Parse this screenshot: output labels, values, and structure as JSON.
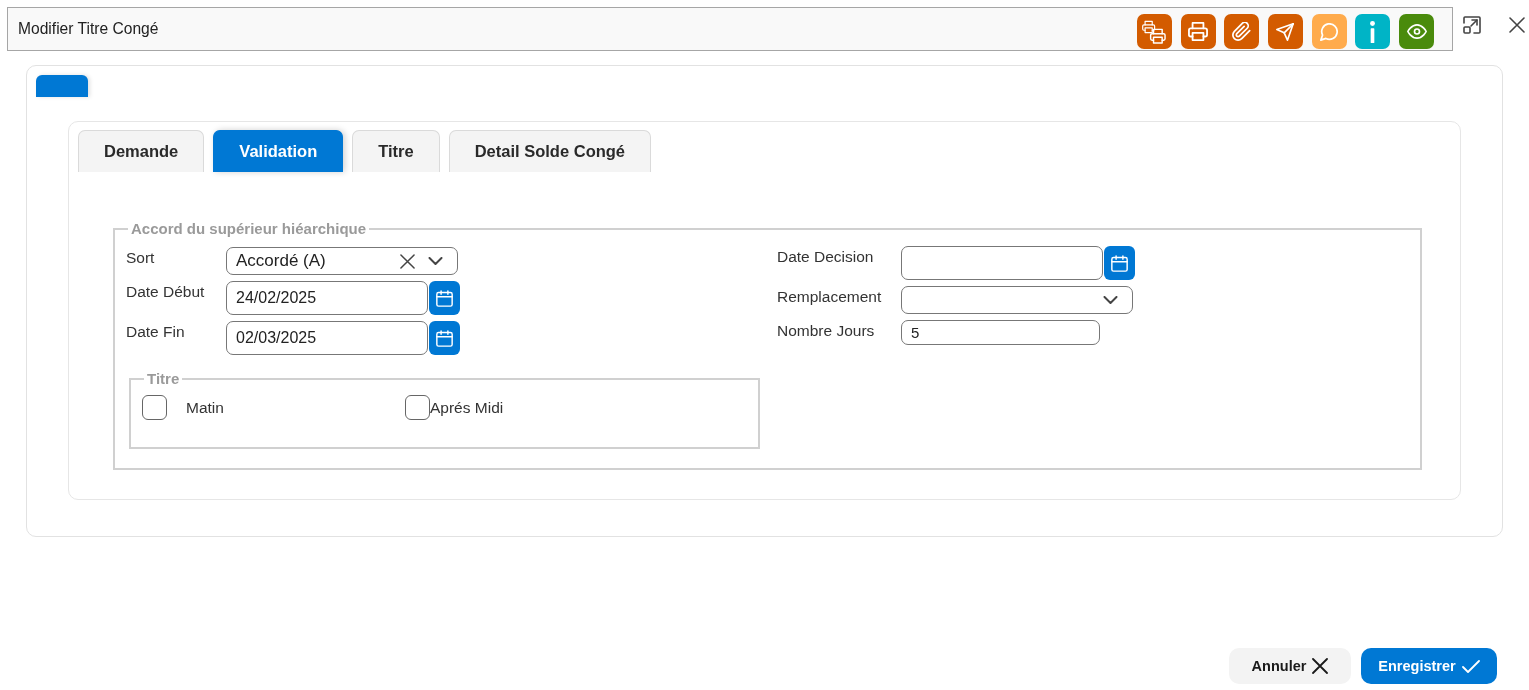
{
  "window": {
    "title": "Modifier Titre Congé"
  },
  "toolbar": [
    {
      "kind": "print-batch",
      "color": "#d35b00"
    },
    {
      "kind": "print",
      "color": "#d35b00"
    },
    {
      "kind": "attach",
      "color": "#d35b00"
    },
    {
      "kind": "send",
      "color": "#d35b00"
    },
    {
      "kind": "comment",
      "color": "#ffab4c"
    },
    {
      "kind": "info",
      "color": "#00b4c6"
    },
    {
      "kind": "view",
      "color": "#4a8b0c"
    }
  ],
  "header_tabs": [
    {
      "selected": true
    }
  ],
  "tabs": [
    {
      "label": "Demande",
      "selected": false
    },
    {
      "label": "Validation",
      "selected": true
    },
    {
      "label": "Titre",
      "selected": false
    },
    {
      "label": "Detail Solde Congé",
      "selected": false
    }
  ],
  "section": {
    "legend": "Accord du supérieur hiéarchique",
    "left_fields": [
      {
        "kind": "select",
        "label": "Sort",
        "value": "Accordé (A)",
        "clearable": true
      },
      {
        "kind": "date",
        "label": "Date Début",
        "value": "24/02/2025"
      },
      {
        "kind": "date",
        "label": "Date Fin",
        "value": "02/03/2025"
      }
    ],
    "right_fields": [
      {
        "kind": "date",
        "label": "Date Decision"
      },
      {
        "kind": "select",
        "label": "Remplacement",
        "clearable": false
      },
      {
        "kind": "number",
        "label": "Nombre Jours",
        "value": "5"
      }
    ],
    "titre": {
      "legend": "Titre",
      "options": [
        {
          "label": "Matin",
          "checked": false
        },
        {
          "label": "Aprés Midi",
          "checked": false
        }
      ]
    }
  },
  "actions": [
    {
      "kind": "cancel",
      "label": "Annuler"
    },
    {
      "kind": "save",
      "label": "Enregistrer"
    }
  ]
}
